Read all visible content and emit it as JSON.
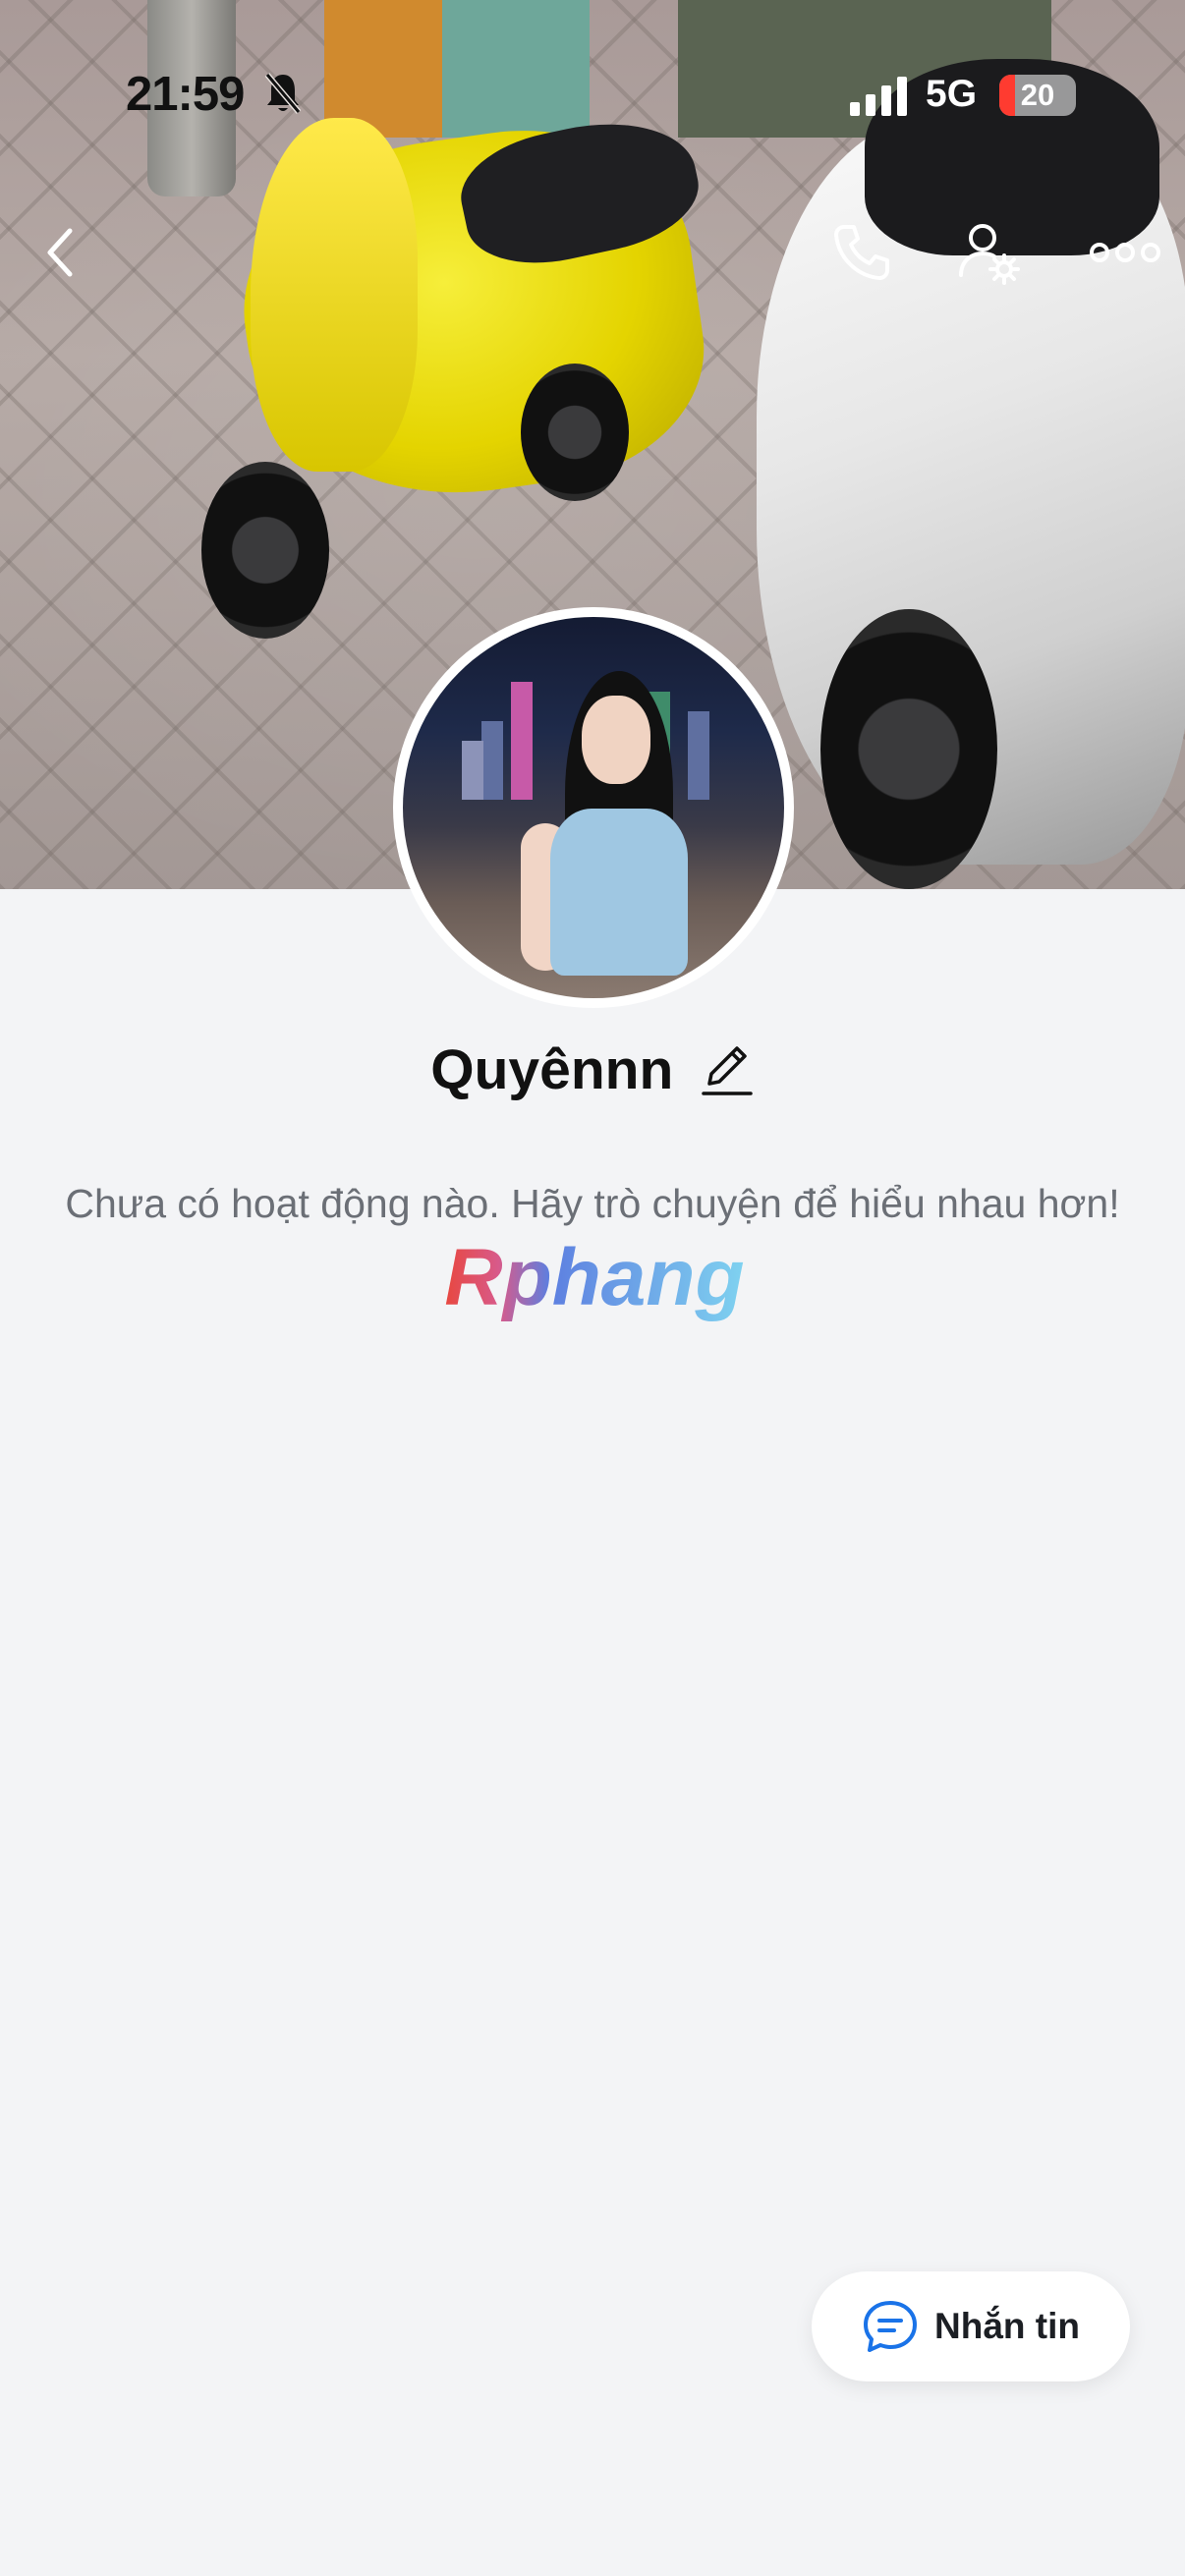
{
  "status_bar": {
    "time": "21:59",
    "network": "5G",
    "battery": "20",
    "battery_level": 0.2
  },
  "icons": {
    "back": "chevron-left-icon",
    "call": "phone-icon",
    "profile_settings": "user-gear-icon",
    "more": "more-horizontal-icon",
    "edit": "pencil-icon",
    "message": "chat-bubble-icon",
    "bell": "bell-slash-icon"
  },
  "profile": {
    "name": "Quyênnn",
    "empty_message": "Chưa có hoạt động nào. Hãy trò chuyện để hiểu nhau hơn!"
  },
  "watermark": "Rphang",
  "actions": {
    "message_label": "Nhắn tin"
  },
  "colors": {
    "background": "#f3f4f6",
    "accent": "#1a73e8",
    "watermark_red": "#e8473f",
    "watermark_blue": "#3aa4e0"
  }
}
